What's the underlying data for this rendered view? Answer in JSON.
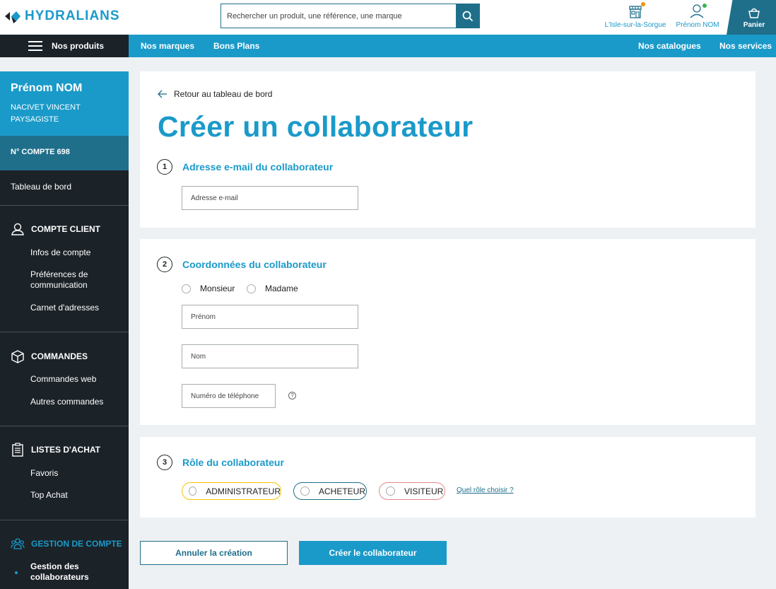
{
  "header": {
    "brand": "HYDRALIANS",
    "search_placeholder": "Rechercher un produit, une référence, une marque",
    "store_label": "L'Isle-sur-la-Sorgue",
    "user_label": "Prénom NOM",
    "cart_label": "Panier",
    "colors": {
      "primary": "#1a9ac9",
      "dark": "#1f6f8b",
      "store_dot": "#f39200",
      "user_dot": "#3cb44b"
    }
  },
  "nav": {
    "products": "Nos produits",
    "brands": "Nos marques",
    "deals": "Bons Plans",
    "catalogues": "Nos catalogues",
    "services": "Nos services"
  },
  "sidebar": {
    "user_name": "Prénom NOM",
    "company_line1": "NACIVET VINCENT",
    "company_line2": "PAYSAGISTE",
    "account_number": "N° COMPTE 698",
    "dashboard": "Tableau de bord",
    "sections": [
      {
        "title": "COMPTE CLIENT",
        "icon": "user-icon",
        "items": [
          "Infos de compte",
          "Préférences de communication",
          "Carnet d'adresses"
        ]
      },
      {
        "title": "COMMANDES",
        "icon": "box-icon",
        "items": [
          "Commandes web",
          "Autres commandes"
        ]
      },
      {
        "title": "LISTES D'ACHAT",
        "icon": "clipboard-icon",
        "items": [
          "Favoris",
          "Top Achat"
        ]
      },
      {
        "title": "GESTION DE COMPTE",
        "icon": "team-icon",
        "items": [
          "Gestion des collaborateurs"
        ]
      }
    ]
  },
  "main": {
    "back_link": "Retour au tableau de bord",
    "title": "Créer un collaborateur",
    "step1": {
      "num": "1",
      "title": "Adresse e-mail du collaborateur",
      "email_placeholder": "Adresse e-mail"
    },
    "step2": {
      "num": "2",
      "title": "Coordonnées du collaborateur",
      "civility": [
        "Monsieur",
        "Madame"
      ],
      "firstname_placeholder": "Prénom",
      "lastname_placeholder": "Nom",
      "phone_placeholder": "Numéro de téléphone",
      "help": "?"
    },
    "step3": {
      "num": "3",
      "title": "Rôle du collaborateur",
      "roles": [
        "ADMINISTRATEUR",
        "ACHETEUR",
        "VISITEUR"
      ],
      "role_colors": [
        "#f5c400",
        "#1f6f8b",
        "#e08a8a"
      ],
      "help_link": "Quel rôle choisir ?"
    },
    "cancel_button": "Annuler la création",
    "create_button": "Créer le collaborateur"
  }
}
